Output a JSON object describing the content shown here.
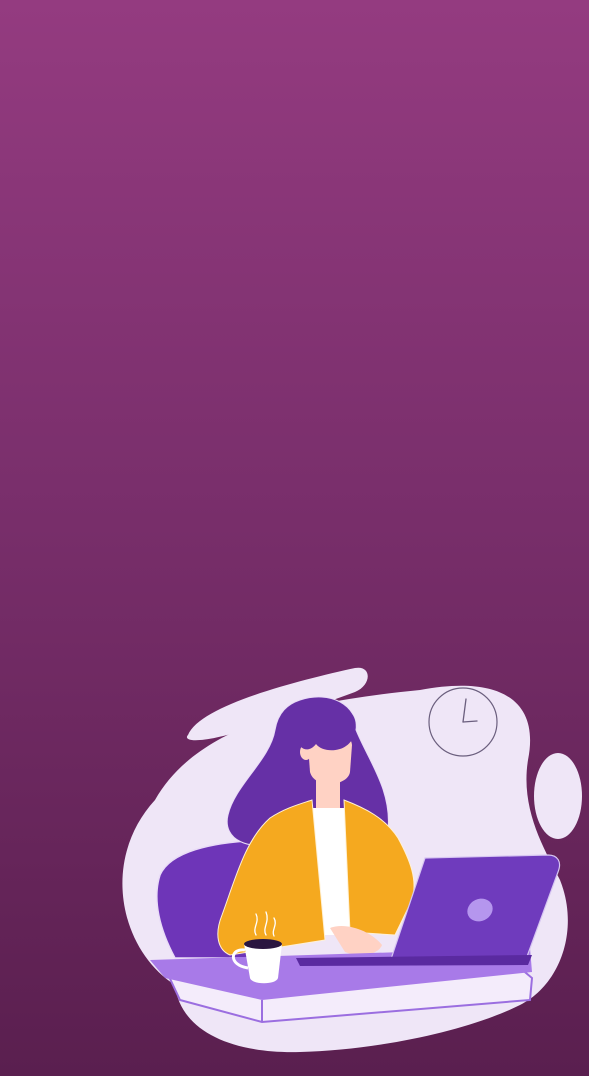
{
  "screen": {
    "background_top": "#943b80",
    "background_bottom": "#5a1f4f"
  },
  "illustration": {
    "subject": "woman-working-on-laptop",
    "colors": {
      "blob": "#efe6f7",
      "hair": "#6630a6",
      "jacket": "#f5a91f",
      "shirt": "#ffffff",
      "skin": "#ffd2c4",
      "chair": "#6e35b8",
      "laptop": "#6f3bbd",
      "desk_top": "#a87ae8",
      "desk_front": "#f4ecfb"
    }
  }
}
